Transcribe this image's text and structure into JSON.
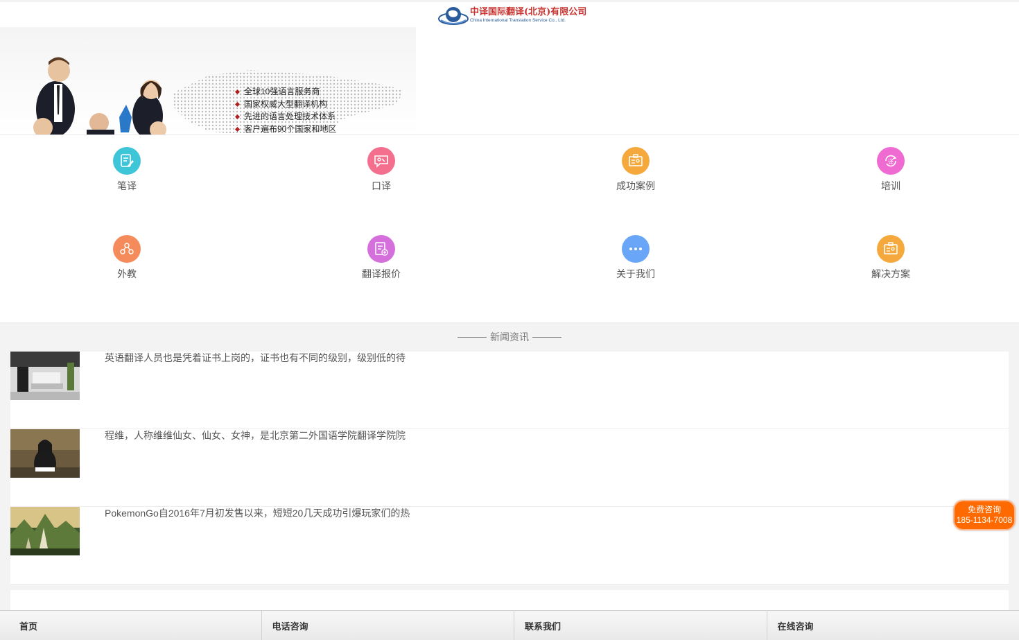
{
  "header": {
    "logo_cn": "中译国际翻译(北京)有限公司",
    "logo_en": "China International Translation Service Co., Ltd."
  },
  "banner": {
    "bullets": [
      "全球10强语言服务商",
      "国家权威大型翻译机构",
      "先进的语言处理技术体系",
      "客户遍布90个国家和地区"
    ]
  },
  "grid": {
    "items": [
      {
        "label": "笔译",
        "icon": "written-translation-icon",
        "color": "#3ec6d8"
      },
      {
        "label": "口译",
        "icon": "interpretation-icon",
        "color": "#f46f8e"
      },
      {
        "label": "成功案例",
        "icon": "success-case-icon",
        "color": "#f5a93c"
      },
      {
        "label": "培训",
        "icon": "training-icon",
        "color": "#ef6ad1"
      },
      {
        "label": "外教",
        "icon": "foreign-teacher-icon",
        "color": "#f58b5b"
      },
      {
        "label": "翻译报价",
        "icon": "quote-icon",
        "color": "#d56fdc"
      },
      {
        "label": "关于我们",
        "icon": "about-us-icon",
        "color": "#69a6f7"
      },
      {
        "label": "解决方案",
        "icon": "solution-icon",
        "color": "#f5a93c"
      }
    ]
  },
  "news": {
    "title": "新闻资讯",
    "items": [
      {
        "text": "英语翻译人员也是凭着证书上岗的，证书也有不同的级别，级别低的待"
      },
      {
        "text": "程维，人称维维仙女、仙女、女神，是北京第二外国语学院翻译学院院"
      },
      {
        "text": "PokemonGo自2016年7月初发售以来，短短20几天成功引爆玩家们的热"
      }
    ]
  },
  "float_consult": {
    "line1": "免费咨询",
    "line2": "185-1134-7008"
  },
  "bottom_nav": {
    "items": [
      "首页",
      "电话咨询",
      "联系我们",
      "在线咨询"
    ]
  },
  "colors": {
    "accent_orange": "#ff6a00",
    "logo_red": "#c8332f",
    "logo_blue": "#2a5b9a"
  }
}
